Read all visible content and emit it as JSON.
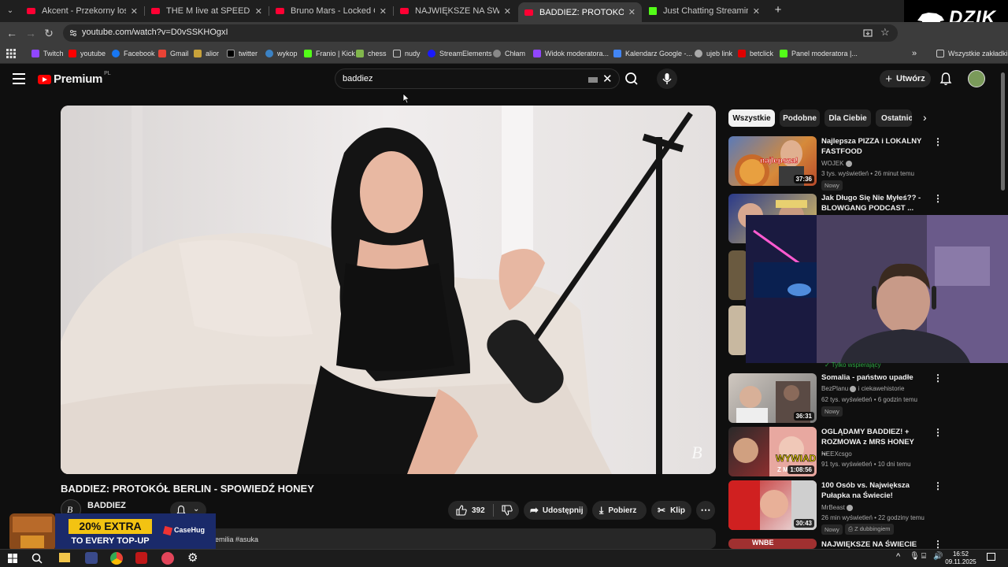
{
  "browser": {
    "tabs": [
      {
        "title": "Akcent - Przekorny los (Oficjalny",
        "icon": "youtube",
        "active": false
      },
      {
        "title": "THE M live at SPEEDLAND FEST",
        "icon": "youtube",
        "active": false
      },
      {
        "title": "Bruno Mars - Locked Out Of Hea",
        "icon": "youtube",
        "active": false
      },
      {
        "title": "NAJWIĘKSZE NA ŚWIECIE ZAW",
        "icon": "youtube",
        "active": false
      },
      {
        "title": "BADDIEZ: PROTOKÓŁ BERLIN -",
        "icon": "youtube",
        "active": true
      },
      {
        "title": "Just Chatting Streaming - Live S",
        "icon": "kick",
        "active": false
      }
    ],
    "new_tab": "+",
    "url": "youtube.com/watch?v=D0vSSKHOgxI",
    "bookmarks": [
      {
        "label": "Twitch",
        "color": "#9146ff"
      },
      {
        "label": "youtube",
        "color": "#ff0000"
      },
      {
        "label": "Facebook",
        "color": "#1877f2"
      },
      {
        "label": "Gmail",
        "color": "#ea4335"
      },
      {
        "label": "alior",
        "color": "#c8a23a"
      },
      {
        "label": "twitter",
        "color": "#000000"
      },
      {
        "label": "wykop",
        "color": "#3b82c4"
      },
      {
        "label": "Franio | Kick",
        "color": "#53fc18"
      },
      {
        "label": "chess",
        "color": "#81b64c"
      },
      {
        "label": "nudy",
        "color": "#777777"
      },
      {
        "label": "StreamElements",
        "color": "#1a1aff"
      },
      {
        "label": "Chłam",
        "color": "#888888"
      },
      {
        "label": "Widok moderatora...",
        "color": "#9146ff"
      },
      {
        "label": "Kalendarz Google -...",
        "color": "#4285f4"
      },
      {
        "label": "ujeb link",
        "color": "#aaaaaa"
      },
      {
        "label": "betclick",
        "color": "#e00000"
      },
      {
        "label": "Panel moderatora |...",
        "color": "#53fc18"
      }
    ],
    "all_bookmarks": "Wszystkie zakładki"
  },
  "overlay_logo": "DZIK",
  "youtube": {
    "logo": "Premium",
    "logo_region": "PL",
    "search_value": "baddiez",
    "create_label": "Utwórz",
    "video": {
      "title": "BADDIEZ: PROTOKÓŁ BERLIN - SPOWIEDŹ HONEY",
      "channel": "BADDIEZ",
      "likes": "392",
      "share": "Udostępnij",
      "download": "Pobierz",
      "clip": "Klip",
      "description_snippet": "emilia #asuka"
    },
    "chips": [
      "Wszystkie",
      "Podobne",
      "Dla Ciebie",
      "Ostatnio"
    ],
    "recommendations": [
      {
        "title": "Najlepsza PIZZA i LOKALNY FASTFOOD",
        "channel": "WOJEK",
        "meta": "3 tys. wyświetleń • 26 minut temu",
        "badge": "Nowy",
        "duration": "37:36",
        "thumb_text": "najlepsza!"
      },
      {
        "title": "Jak Długo Się Nie Myłeś?? - BLOWGANG PODCAST ...",
        "channel": "",
        "meta": "",
        "badge": "",
        "duration": "",
        "thumb_text": ""
      },
      {
        "title": "Somalia - państwo upadłe",
        "channel": "BezPlanu",
        "channel_extra": "i ciekawehistorie",
        "meta": "62 tys. wyświetleń • 6 godzin temu",
        "badge": "Nowy",
        "duration": "36:31",
        "thumb_text": ""
      },
      {
        "title": "OGLĄDAMY BADDIEZ! + ROZMOWA z MRS HONEY ...",
        "channel": "NEEXcsgo",
        "meta": "91 tys. wyświetleń • 10 dni temu",
        "badge": "",
        "duration": "1:08:56",
        "thumb_text": "WYWIAD Z MRS.H"
      },
      {
        "title": "100 Osób vs. Największa Pułapka na Świecie!",
        "channel": "MrBeast",
        "meta": "26 min wyświetleń • 22 godziny temu",
        "badge": "Nowy",
        "badge2": "Z dubbingiem",
        "duration": "30:43",
        "thumb_text": ""
      },
      {
        "title": "NAJWIĘKSZE NA ŚWIECIE",
        "channel": "",
        "meta": "",
        "badge": "",
        "duration": "",
        "thumb_text": "WNBE"
      }
    ],
    "members_only": "Tylko wspierający"
  },
  "ad": {
    "line1": "20% EXTRA",
    "line2": "TO EVERY TOP-UP",
    "brand": "CaseHug"
  },
  "taskbar": {
    "time": "16:52",
    "date": "09.11.2025"
  }
}
